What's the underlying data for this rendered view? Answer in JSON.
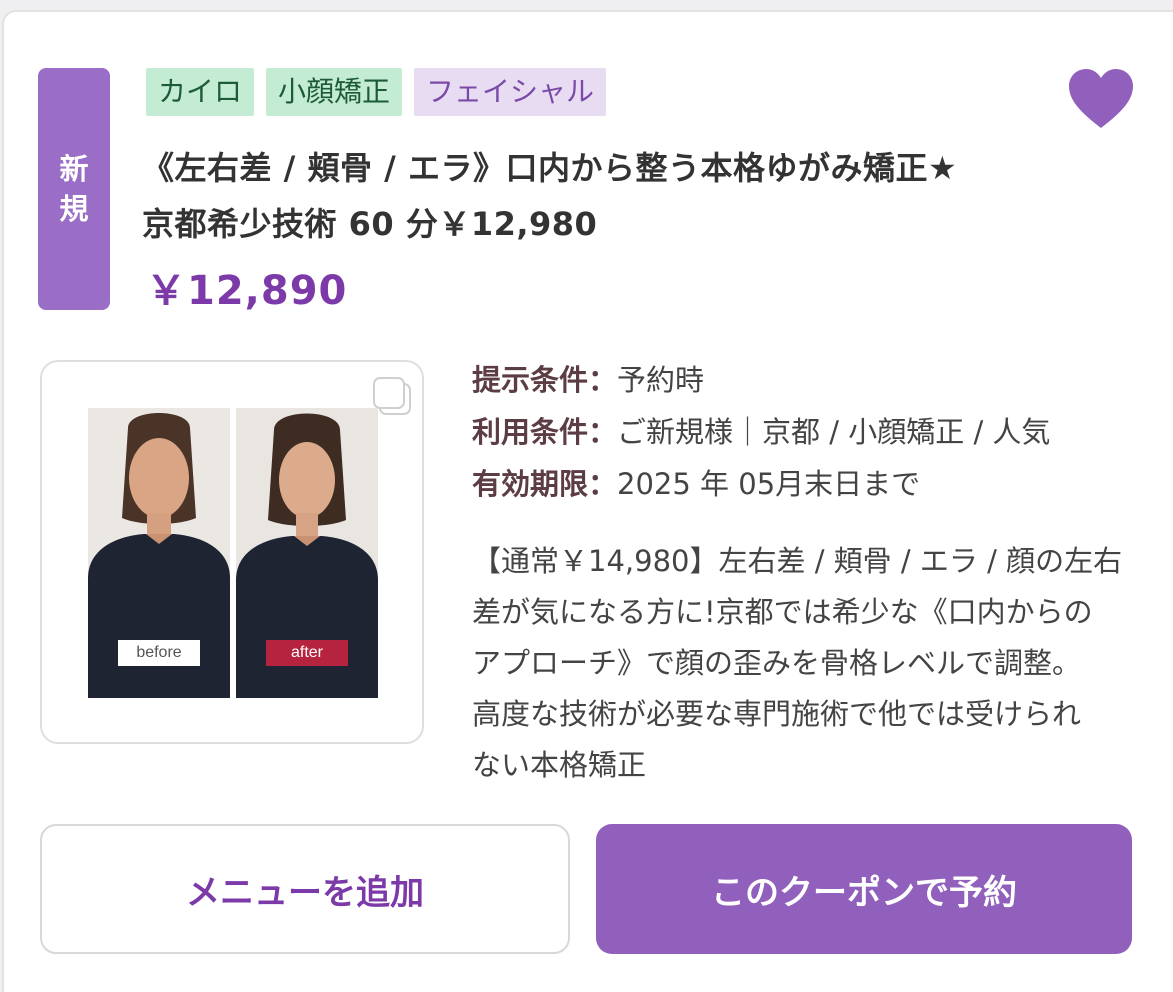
{
  "badge": {
    "line1": "新",
    "line2": "規"
  },
  "tags": [
    {
      "label": "カイロ",
      "style": "green"
    },
    {
      "label": "小顔矯正",
      "style": "green"
    },
    {
      "label": "フェイシャル",
      "style": "purple"
    }
  ],
  "coupon": {
    "title_line1": "《左右差 / 頬骨 / エラ》口内から整う本格ゆがみ矯正★",
    "title_line2": "京都希少技術 60 分￥12,980",
    "price": "￥12,890"
  },
  "photo": {
    "before_label": "before",
    "after_label": "after"
  },
  "conditions": [
    {
      "key": "提示条件：",
      "value": "予約時"
    },
    {
      "key": "利用条件：",
      "value": "ご新規様｜京都 / 小顔矯正 / 人気"
    },
    {
      "key": "有効期限：",
      "value": "2025 年 05月末日まで"
    }
  ],
  "description": [
    "【通常￥14,980】左右差 / 頬骨 / エラ / 顔の左右",
    "差が気になる方に!京都では希少な《口内からの",
    "アプローチ》で顔の歪みを骨格レベルで調整。",
    "高度な技術が必要な専門施術で他では受けられ",
    "ない本格矯正"
  ],
  "buttons": {
    "add_menu": "メニューを追加",
    "reserve": "このクーポンで予約"
  },
  "colors": {
    "accent": "#9060bc",
    "price": "#7c3aa8",
    "tag_green_bg": "#c4ecd5",
    "tag_purple_bg": "#e8dcf3",
    "after_label_bg": "#b5233f"
  },
  "icons": {
    "favorite": "heart-icon",
    "gallery": "gallery-icon"
  }
}
